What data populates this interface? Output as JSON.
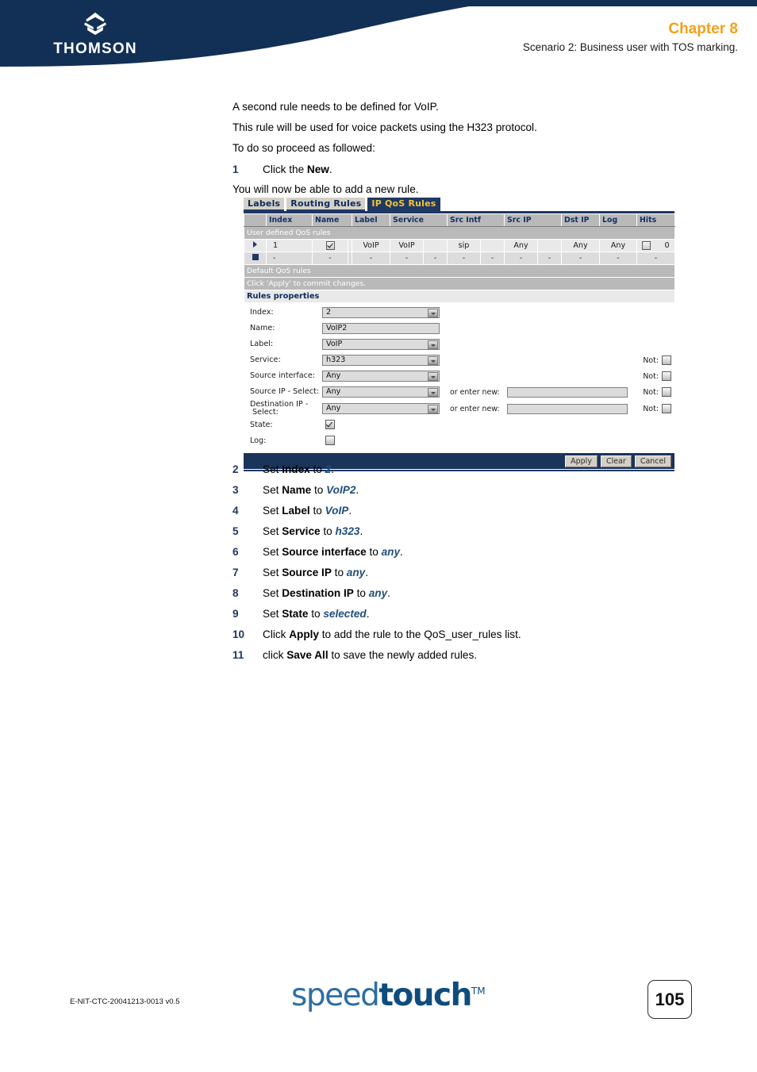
{
  "header": {
    "brand": "THOMSON",
    "brand_icon": "thomson-diamond-logo",
    "chapter": "Chapter 8",
    "subtitle": "Scenario 2: Business user with TOS marking."
  },
  "content": {
    "paragraphs": [
      "A second rule needs to be defined for VoIP.",
      "This rule will be used for voice packets using the H323 protocol.",
      "To do so proceed as followed:"
    ],
    "step1": {
      "num": "1",
      "pre": "Click the ",
      "bold": "New",
      "post": "."
    },
    "after_step1": "You will now be able to add a new rule.",
    "steps": [
      {
        "num": "2",
        "pre": "Set ",
        "bold": "Index",
        "mid": " to ",
        "italic": "2",
        "post": "."
      },
      {
        "num": "3",
        "pre": "Set ",
        "bold": "Name",
        "mid": " to ",
        "italic": "VoIP2",
        "post": "."
      },
      {
        "num": "4",
        "pre": "Set ",
        "bold": "Label",
        "mid": " to ",
        "italic": "VoIP",
        "post": "."
      },
      {
        "num": "5",
        "pre": "Set ",
        "bold": "Service",
        "mid": " to ",
        "italic": "h323",
        "post": "."
      },
      {
        "num": "6",
        "pre": "Set ",
        "bold": "Source interface",
        "mid": " to ",
        "italic": "any",
        "post": "."
      },
      {
        "num": "7",
        "pre": "Set ",
        "bold": "Source IP",
        "mid": " to ",
        "italic": "any",
        "post": "."
      },
      {
        "num": "8",
        "pre": "Set ",
        "bold": "Destination IP",
        "mid": " to ",
        "italic": "any",
        "post": "."
      },
      {
        "num": "9",
        "pre": "Set ",
        "bold": "State",
        "mid": " to ",
        "italic": "selected",
        "post": "."
      },
      {
        "num": "10",
        "pre": "Click ",
        "bold": "Apply",
        "mid": " to add the rule to the QoS_user_rules list.",
        "italic": "",
        "post": ""
      },
      {
        "num": "11",
        "pre": "click ",
        "bold": "Save All",
        "mid": " to save the newly added rules.",
        "italic": "",
        "post": ""
      }
    ]
  },
  "ui": {
    "tabs": [
      {
        "label": "Labels",
        "active": false
      },
      {
        "label": "Routing Rules",
        "active": false
      },
      {
        "label": "IP QoS Rules",
        "active": true
      }
    ],
    "table": {
      "headers": [
        "",
        "Index",
        "Name",
        "",
        "Label",
        "Service",
        "",
        "Src Intf",
        "",
        "Src IP",
        "",
        "Dst IP",
        "Log",
        "Hits"
      ],
      "section_user": "User defined QoS rules",
      "rows": [
        {
          "marker": "triangle",
          "index": "1",
          "name_check": "checked",
          "name": "VoIP",
          "label": "VoIP",
          "sep1": "",
          "service": "sip",
          "sep2": "",
          "src_intf": "Any",
          "sep3": "",
          "src_ip": "Any",
          "sep4": "",
          "dst_ip": "Any",
          "log": "unchecked",
          "hits": "0"
        },
        {
          "marker": "square",
          "index": "-",
          "name_check": "-",
          "name": "-",
          "label": "-",
          "sep1": "-",
          "service": "-",
          "sep2": "-",
          "src_intf": "-",
          "sep3": "-",
          "src_ip": "-",
          "sep4": "-",
          "dst_ip": "-",
          "log": "-",
          "hits": "-"
        }
      ],
      "section_default": "Default QoS rules",
      "commit_note": "Click 'Apply' to commit changes.",
      "properties_title": "Rules properties"
    },
    "form": {
      "fields": [
        {
          "label": "Index:",
          "value": "2",
          "control": "select",
          "not": false,
          "enter_new": false
        },
        {
          "label": "Name:",
          "value": "VoIP2",
          "control": "text",
          "not": false,
          "enter_new": false
        },
        {
          "label": "Label:",
          "value": "VoIP",
          "control": "select",
          "not": false,
          "enter_new": false
        },
        {
          "label": "Service:",
          "value": "h323",
          "control": "select",
          "not": true,
          "enter_new": false
        },
        {
          "label": "Source interface:",
          "value": "Any",
          "control": "select",
          "not": true,
          "enter_new": false
        },
        {
          "label": "Source IP - Select:",
          "value": "Any",
          "control": "select",
          "not": true,
          "enter_new": true
        },
        {
          "label": "Destination IP - Select:",
          "value": "Any",
          "control": "select",
          "not": true,
          "enter_new": true
        }
      ],
      "enter_new_label": "or enter new:",
      "enter_new_value": "",
      "not_label": "Not:",
      "state_label": "State:",
      "state_checked": true,
      "log_label": "Log:",
      "log_checked": false
    },
    "buttons": [
      {
        "label": "Apply"
      },
      {
        "label": "Clear"
      },
      {
        "label": "Cancel"
      }
    ]
  },
  "footer": {
    "doc_ref": "E-NIT-CTC-20041213-0013 v0.5",
    "logo_light": "speed",
    "logo_bold": "touch",
    "logo_tm": "TM",
    "page_number": "105"
  },
  "colors": {
    "brand_navy": "#1F3864",
    "header_navy": "#123055",
    "chapter_orange": "#F4A11B",
    "tab_yellow": "#F4C430",
    "step_blue": "#1F4E79"
  }
}
